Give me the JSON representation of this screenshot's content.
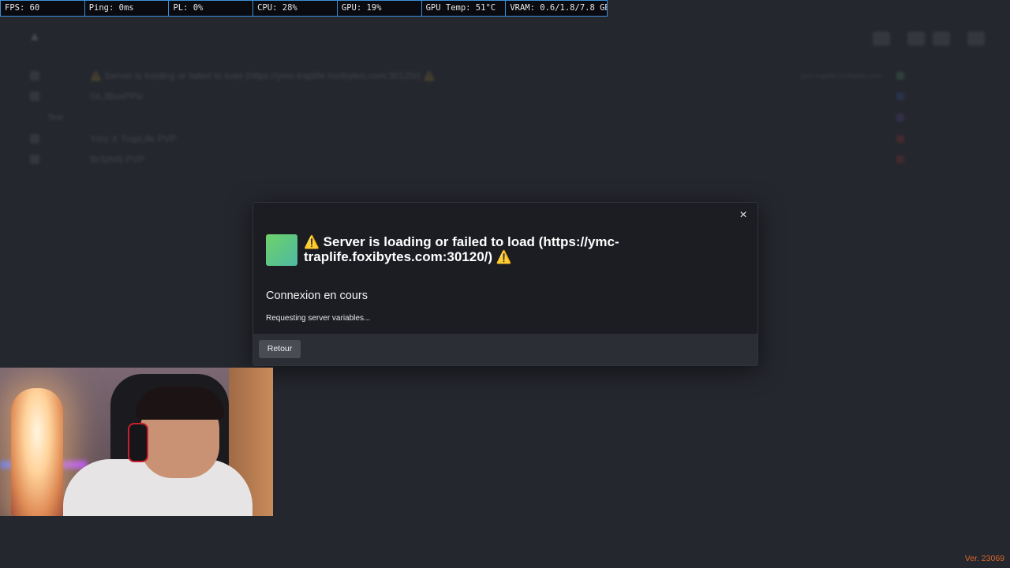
{
  "perf_overlay": {
    "fps": "FPS: 60",
    "ping": "Ping: 0ms",
    "pl": "PL: 0%",
    "cpu": "CPU: 28%",
    "gpu": "GPU: 19%",
    "gpu_temp": "GPU Temp: 51°C",
    "vram": "VRAM: 0.6/1.8/7.8 GB"
  },
  "background": {
    "logo_icon": "fivem-logo-icon",
    "rows": [
      {
        "name": "⚠️ Server is loading or failed to load (https://ymc-traplife.foxibytes.com:30120/) ⚠️",
        "url": "ymc-traplife.foxibytes.com",
        "color": "#5cc487"
      },
      {
        "name": "GLJBoxPPix",
        "url": "",
        "color": "#3b6fd0"
      },
      {
        "name": "",
        "url": "",
        "color": "#7a5cd1",
        "label": "Test"
      },
      {
        "name": "Ymz X TrapLife PVP",
        "url": "",
        "color": "#d33b3b"
      },
      {
        "name": "Br3zhiS PVP",
        "url": "",
        "color": "#d33b3b"
      }
    ]
  },
  "modal": {
    "close_icon": "×",
    "title": "Server is loading or failed to load (https://ymc-traplife.foxibytes.com:30120/)",
    "warning_glyph": "⚠️",
    "status_heading": "Connexion en cours",
    "status_detail": "Requesting server variables...",
    "back_button": "Retour"
  },
  "webcam": {
    "label": "streamer-webcam"
  },
  "version": "Ver. 23069"
}
